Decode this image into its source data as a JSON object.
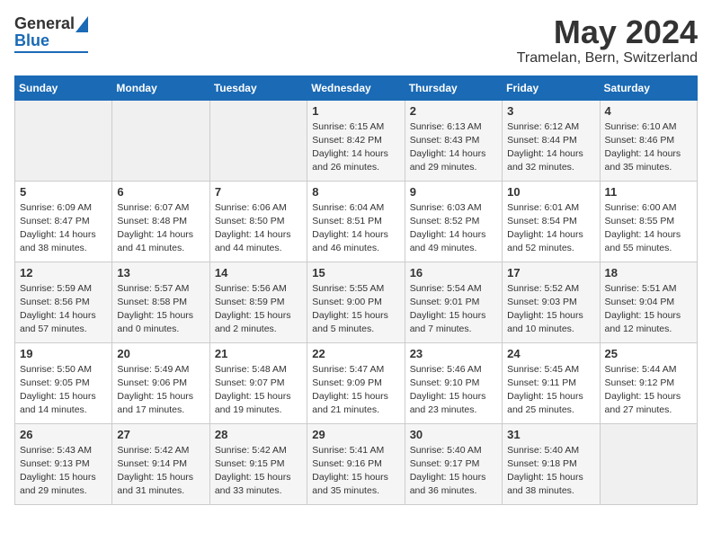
{
  "header": {
    "logo": {
      "line1": "General",
      "line2": "Blue"
    },
    "title": "May 2024",
    "subtitle": "Tramelan, Bern, Switzerland"
  },
  "calendar": {
    "headers": [
      "Sunday",
      "Monday",
      "Tuesday",
      "Wednesday",
      "Thursday",
      "Friday",
      "Saturday"
    ],
    "rows": [
      [
        {
          "day": "",
          "info": ""
        },
        {
          "day": "",
          "info": ""
        },
        {
          "day": "",
          "info": ""
        },
        {
          "day": "1",
          "info": "Sunrise: 6:15 AM\nSunset: 8:42 PM\nDaylight: 14 hours\nand 26 minutes."
        },
        {
          "day": "2",
          "info": "Sunrise: 6:13 AM\nSunset: 8:43 PM\nDaylight: 14 hours\nand 29 minutes."
        },
        {
          "day": "3",
          "info": "Sunrise: 6:12 AM\nSunset: 8:44 PM\nDaylight: 14 hours\nand 32 minutes."
        },
        {
          "day": "4",
          "info": "Sunrise: 6:10 AM\nSunset: 8:46 PM\nDaylight: 14 hours\nand 35 minutes."
        }
      ],
      [
        {
          "day": "5",
          "info": "Sunrise: 6:09 AM\nSunset: 8:47 PM\nDaylight: 14 hours\nand 38 minutes."
        },
        {
          "day": "6",
          "info": "Sunrise: 6:07 AM\nSunset: 8:48 PM\nDaylight: 14 hours\nand 41 minutes."
        },
        {
          "day": "7",
          "info": "Sunrise: 6:06 AM\nSunset: 8:50 PM\nDaylight: 14 hours\nand 44 minutes."
        },
        {
          "day": "8",
          "info": "Sunrise: 6:04 AM\nSunset: 8:51 PM\nDaylight: 14 hours\nand 46 minutes."
        },
        {
          "day": "9",
          "info": "Sunrise: 6:03 AM\nSunset: 8:52 PM\nDaylight: 14 hours\nand 49 minutes."
        },
        {
          "day": "10",
          "info": "Sunrise: 6:01 AM\nSunset: 8:54 PM\nDaylight: 14 hours\nand 52 minutes."
        },
        {
          "day": "11",
          "info": "Sunrise: 6:00 AM\nSunset: 8:55 PM\nDaylight: 14 hours\nand 55 minutes."
        }
      ],
      [
        {
          "day": "12",
          "info": "Sunrise: 5:59 AM\nSunset: 8:56 PM\nDaylight: 14 hours\nand 57 minutes."
        },
        {
          "day": "13",
          "info": "Sunrise: 5:57 AM\nSunset: 8:58 PM\nDaylight: 15 hours\nand 0 minutes."
        },
        {
          "day": "14",
          "info": "Sunrise: 5:56 AM\nSunset: 8:59 PM\nDaylight: 15 hours\nand 2 minutes."
        },
        {
          "day": "15",
          "info": "Sunrise: 5:55 AM\nSunset: 9:00 PM\nDaylight: 15 hours\nand 5 minutes."
        },
        {
          "day": "16",
          "info": "Sunrise: 5:54 AM\nSunset: 9:01 PM\nDaylight: 15 hours\nand 7 minutes."
        },
        {
          "day": "17",
          "info": "Sunrise: 5:52 AM\nSunset: 9:03 PM\nDaylight: 15 hours\nand 10 minutes."
        },
        {
          "day": "18",
          "info": "Sunrise: 5:51 AM\nSunset: 9:04 PM\nDaylight: 15 hours\nand 12 minutes."
        }
      ],
      [
        {
          "day": "19",
          "info": "Sunrise: 5:50 AM\nSunset: 9:05 PM\nDaylight: 15 hours\nand 14 minutes."
        },
        {
          "day": "20",
          "info": "Sunrise: 5:49 AM\nSunset: 9:06 PM\nDaylight: 15 hours\nand 17 minutes."
        },
        {
          "day": "21",
          "info": "Sunrise: 5:48 AM\nSunset: 9:07 PM\nDaylight: 15 hours\nand 19 minutes."
        },
        {
          "day": "22",
          "info": "Sunrise: 5:47 AM\nSunset: 9:09 PM\nDaylight: 15 hours\nand 21 minutes."
        },
        {
          "day": "23",
          "info": "Sunrise: 5:46 AM\nSunset: 9:10 PM\nDaylight: 15 hours\nand 23 minutes."
        },
        {
          "day": "24",
          "info": "Sunrise: 5:45 AM\nSunset: 9:11 PM\nDaylight: 15 hours\nand 25 minutes."
        },
        {
          "day": "25",
          "info": "Sunrise: 5:44 AM\nSunset: 9:12 PM\nDaylight: 15 hours\nand 27 minutes."
        }
      ],
      [
        {
          "day": "26",
          "info": "Sunrise: 5:43 AM\nSunset: 9:13 PM\nDaylight: 15 hours\nand 29 minutes."
        },
        {
          "day": "27",
          "info": "Sunrise: 5:42 AM\nSunset: 9:14 PM\nDaylight: 15 hours\nand 31 minutes."
        },
        {
          "day": "28",
          "info": "Sunrise: 5:42 AM\nSunset: 9:15 PM\nDaylight: 15 hours\nand 33 minutes."
        },
        {
          "day": "29",
          "info": "Sunrise: 5:41 AM\nSunset: 9:16 PM\nDaylight: 15 hours\nand 35 minutes."
        },
        {
          "day": "30",
          "info": "Sunrise: 5:40 AM\nSunset: 9:17 PM\nDaylight: 15 hours\nand 36 minutes."
        },
        {
          "day": "31",
          "info": "Sunrise: 5:40 AM\nSunset: 9:18 PM\nDaylight: 15 hours\nand 38 minutes."
        },
        {
          "day": "",
          "info": ""
        }
      ]
    ]
  }
}
